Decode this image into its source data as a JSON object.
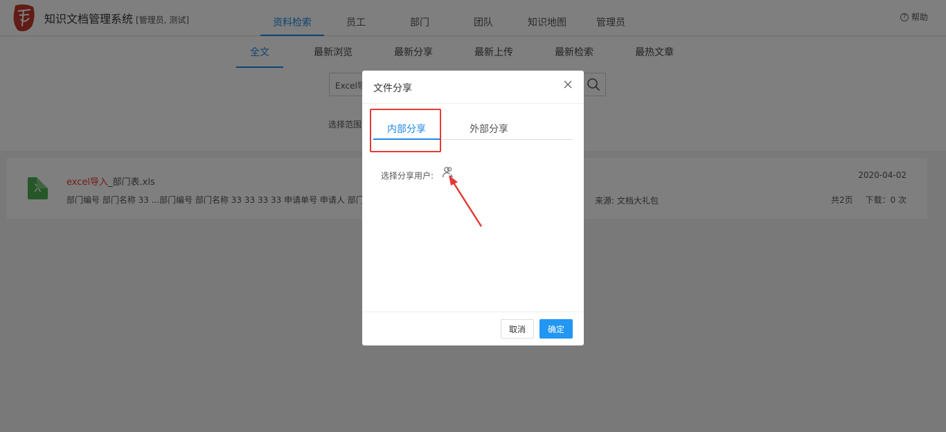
{
  "header": {
    "app_title": "知识文档管理系统",
    "user_role": "[管理员, 测试]",
    "nav": [
      "资料检索",
      "员工",
      "部门",
      "团队",
      "知识地图",
      "管理员"
    ],
    "help": "帮助"
  },
  "subnav": [
    "全文",
    "最新浏览",
    "最新分享",
    "最新上传",
    "最新检索",
    "最热文章"
  ],
  "search": {
    "value": "Excel导"
  },
  "scope_label": "选择范围",
  "result": {
    "file_type_icon": "X",
    "name_highlight": "excel导入",
    "name_rest": "_部门表.xls",
    "snippet": "部门编号 部门名称 33 ...部门编号 部门名称 33 33 33 33 申请单号 申请人 部门编",
    "date": "2020-04-02",
    "source": "来源: 文档大礼包",
    "pages": "共2页",
    "downloads": "下载：0 次"
  },
  "modal": {
    "title": "文件分享",
    "tabs": [
      "内部分享",
      "外部分享"
    ],
    "share_user_label": "选择分享用户:",
    "cancel": "取消",
    "confirm": "确定"
  },
  "colors": {
    "accent": "#1e88e5",
    "highlight": "#e53935",
    "primary_button": "#2196f3"
  }
}
